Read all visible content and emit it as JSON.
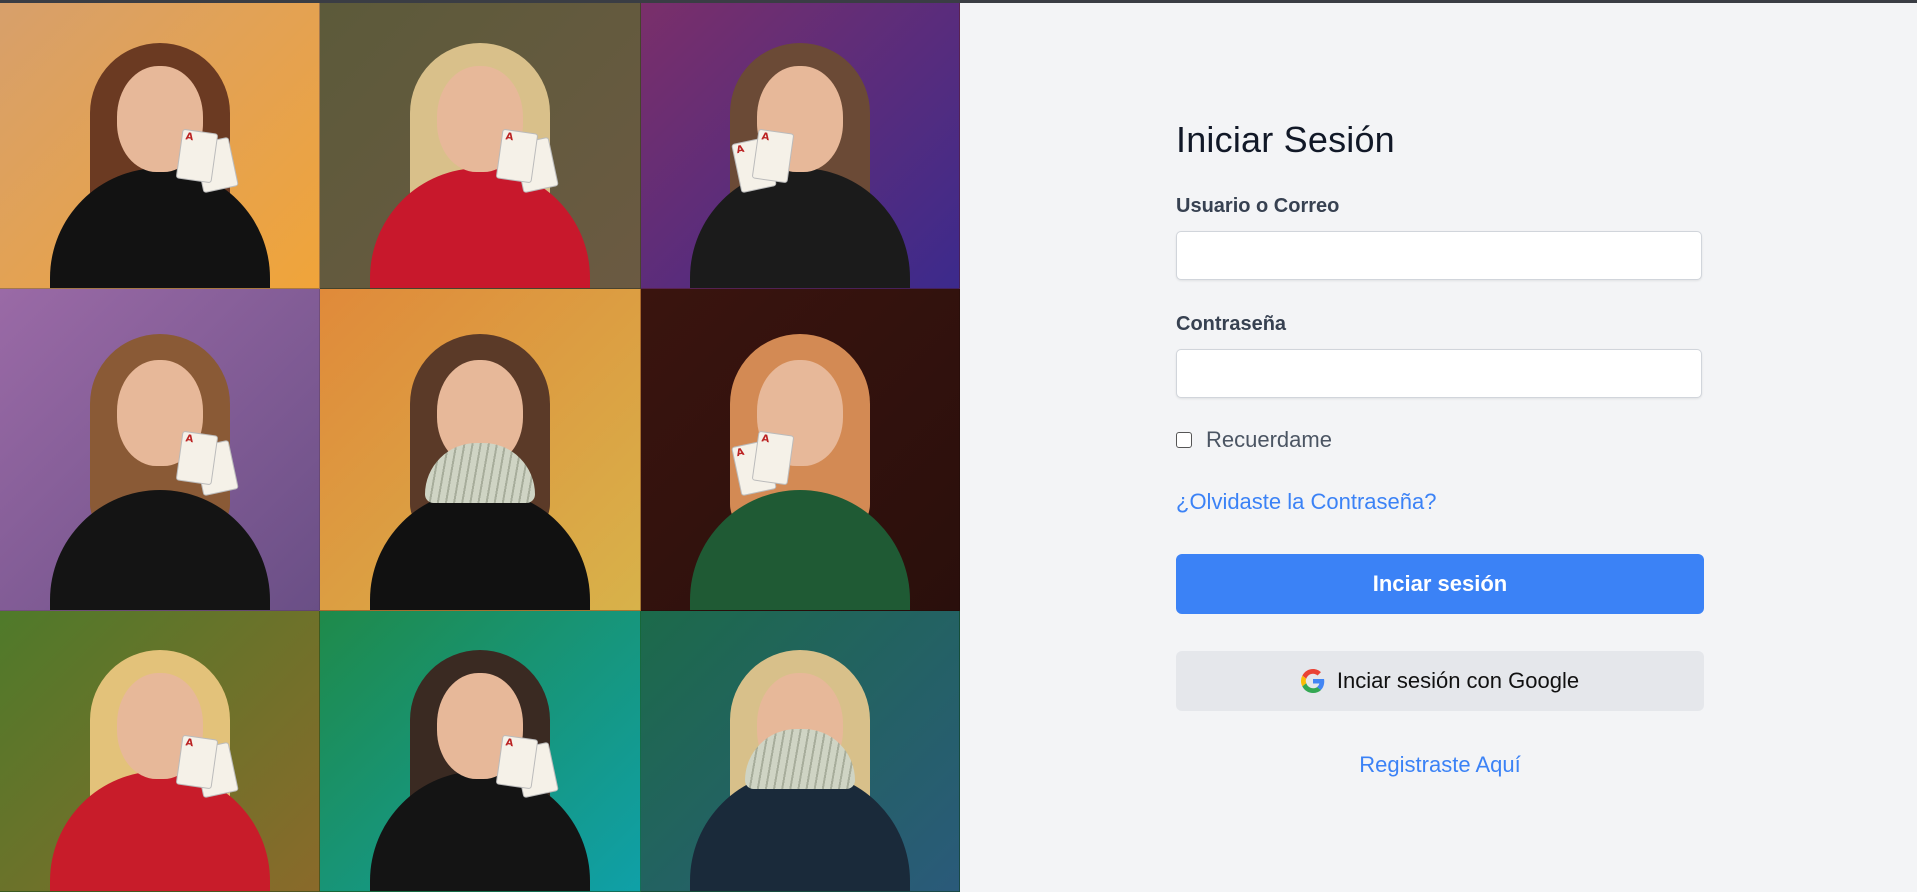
{
  "login": {
    "title": "Iniciar Sesión",
    "username_label": "Usuario o Correo",
    "username_value": "",
    "password_label": "Contraseña",
    "password_value": "",
    "remember_label": "Recuerdame",
    "remember_checked": false,
    "forgot_link": "¿Olvidaste la Contraseña?",
    "submit_button": "Inciar sesión",
    "google_button": "Inciar sesión con Google",
    "register_link": "Registraste Aquí"
  },
  "colors": {
    "accent": "#3b82f6",
    "page_background": "#f3f4f6",
    "secondary_button": "#e5e7eb"
  },
  "gallery": {
    "tiles": [
      {
        "bg": "linear-gradient(135deg,#d7a06b,#f0a43a)",
        "hair": "#6b3a22",
        "dress": "#121212",
        "props": "cards"
      },
      {
        "bg": "linear-gradient(135deg,#5c5a3a,#6b5a42)",
        "hair": "#d9c08a",
        "dress": "#c8182c",
        "props": "cards"
      },
      {
        "bg": "linear-gradient(135deg,#7a2f6a,#3c2a8c)",
        "hair": "#6b4a36",
        "dress": "#1b1b1b",
        "props": "cards"
      },
      {
        "bg": "linear-gradient(135deg,#9a6aa6,#6a4f86)",
        "hair": "#8a5a36",
        "dress": "#141414",
        "props": "cards"
      },
      {
        "bg": "linear-gradient(135deg,#e08a3a,#d8b24a)",
        "hair": "#5b3a28",
        "dress": "#111111",
        "props": "bills"
      },
      {
        "bg": "linear-gradient(135deg,#3a140e,#2a0f0c)",
        "hair": "#d38a54",
        "dress": "#1f5a34",
        "props": "cards"
      },
      {
        "bg": "linear-gradient(135deg,#4f7a2a,#8a6a2a)",
        "hair": "#e3c27a",
        "dress": "#c81c2a",
        "props": "cards"
      },
      {
        "bg": "linear-gradient(135deg,#1f8a4a,#0fa0a8)",
        "hair": "#3a2a22",
        "dress": "#141414",
        "props": "cards"
      },
      {
        "bg": "linear-gradient(135deg,#1c6a4a,#2a5a7a)",
        "hair": "#d8c08a",
        "dress": "#1a2a3a",
        "props": "bills"
      }
    ]
  }
}
